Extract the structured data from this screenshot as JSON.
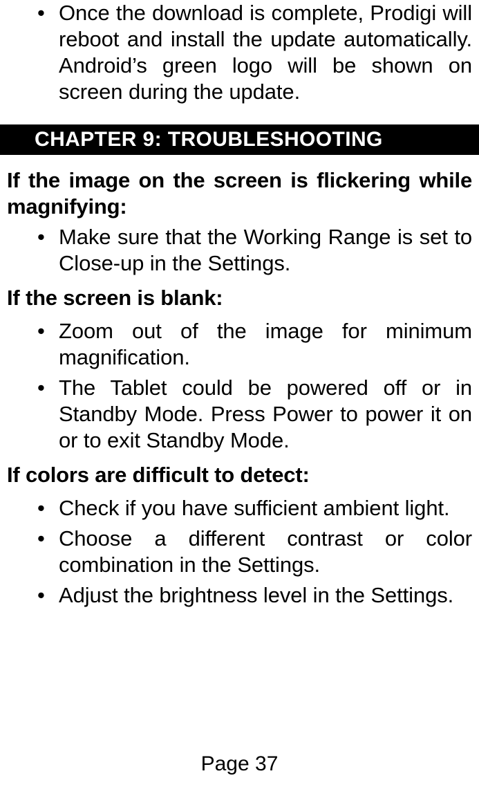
{
  "document": {
    "type": "user-manual-page",
    "page_number_label": "Page 37"
  },
  "intro_bullets": [
    {
      "marker": "•",
      "text": "Once the download is complete, Prodigi will reboot and install the update automatically. Android’s green logo will be shown on screen during the update."
    }
  ],
  "chapter": {
    "title": "CHAPTER 9: TROUBLESHOOTING",
    "background_color": "#000000",
    "text_color": "#ffffff"
  },
  "sections": [
    {
      "heading": "If the image on the screen is flickering while magnifying:",
      "bullets": [
        {
          "marker": "•",
          "text": "Make sure that the Working Range is set to Close-up in the Settings."
        }
      ]
    },
    {
      "heading": "If the screen is blank:",
      "bullets": [
        {
          "marker": "•",
          "text": "Zoom out of the image for minimum magnification."
        },
        {
          "marker": "•",
          "text": "The Tablet could be powered off or in Standby Mode. Press Power to power it on or to exit Standby Mode."
        }
      ]
    },
    {
      "heading": "If colors are difficult to detect:",
      "bullets": [
        {
          "marker": "•",
          "text": "Check if you have sufficient ambient light."
        },
        {
          "marker": "•",
          "text": "Choose a different contrast or color combination in the Settings."
        },
        {
          "marker": "•",
          "text": "Adjust the brightness level in the Settings."
        }
      ]
    }
  ]
}
